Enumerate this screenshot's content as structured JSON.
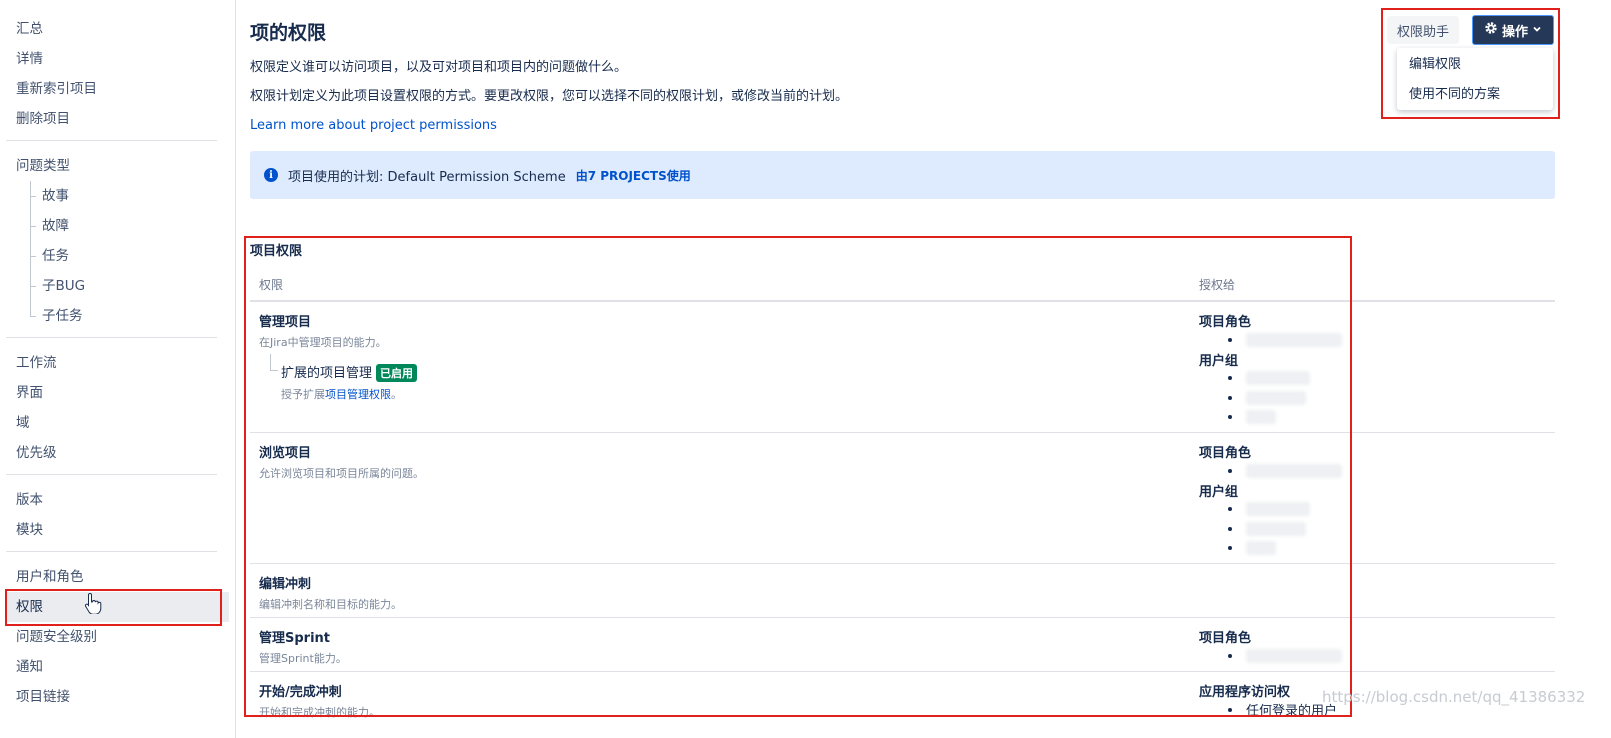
{
  "sidebar": {
    "group1": [
      "汇总",
      "详情",
      "重新索引项目",
      "删除项目"
    ],
    "group2_title": "问题类型",
    "issue_types": [
      "故事",
      "故障",
      "任务",
      "子BUG",
      "子任务"
    ],
    "group3": [
      "工作流",
      "界面",
      "域",
      "优先级"
    ],
    "group4": [
      "版本",
      "模块"
    ],
    "group5": [
      "用户和角色",
      "权限",
      "问题安全级别",
      "通知",
      "项目链接"
    ]
  },
  "header": {
    "title": "项的权限",
    "desc1": "权限定义谁可以访问项目，以及可对项目和项目内的问题做什么。",
    "desc2": "权限计划定义为此项目设置权限的方式。要更改权限，您可以选择不同的权限计划，或修改当前的计划。",
    "learn_more": "Learn more about project permissions",
    "helper_button": "权限助手",
    "ops_button": "操作",
    "dropdown": [
      "编辑权限",
      "使用不同的方案"
    ]
  },
  "info": {
    "prefix": "项目使用的计划: Default Permission Scheme",
    "link": "由7 PROJECTS使用"
  },
  "table": {
    "section_title": "项目权限",
    "col_permission": "权限",
    "col_granted": "授权给",
    "rows": [
      {
        "name": "管理项目",
        "desc": "在Jira中管理项目的能力。",
        "sub_name": "扩展的项目管理",
        "sub_badge": "已启用",
        "sub_desc_prefix": "授予扩展",
        "sub_desc_link": "项目管理权限",
        "sub_desc_suffix": "。",
        "grant_role_head": "项目角色",
        "grant_group_head": "用户组"
      },
      {
        "name": "浏览项目",
        "desc": "允许浏览项目和项目所属的问题。",
        "grant_role_head": "项目角色",
        "grant_group_head": "用户组"
      },
      {
        "name": "编辑冲刺",
        "desc": "编辑冲刺名称和目标的能力。"
      },
      {
        "name": "管理Sprint",
        "desc": "管理Sprint能力。",
        "grant_role_head": "项目角色"
      },
      {
        "name": "开始/完成冲刺",
        "desc": "开始和完成冲刺的能力。",
        "grant_head": "应用程序访问权",
        "grant_item": "任何登录的用户"
      }
    ]
  },
  "watermark": "https://blog.csdn.net/qq_41386332",
  "colors": {
    "accent": "#0052cc",
    "highlight": "#e0201b",
    "lozenge": "#00875a",
    "ops_button": "#253858"
  }
}
